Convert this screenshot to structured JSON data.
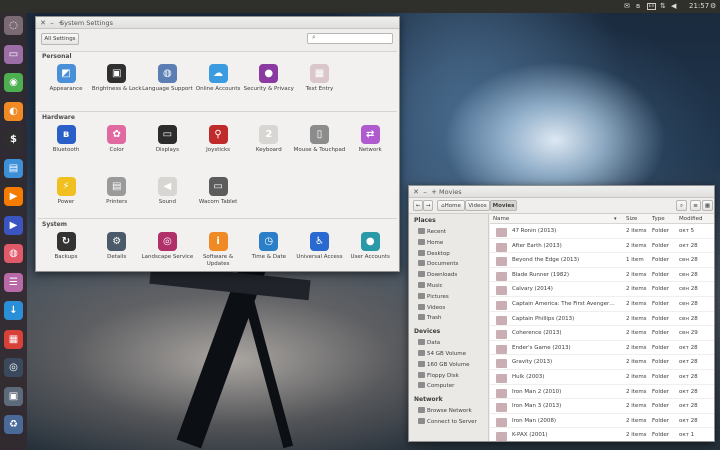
{
  "topbar": {
    "clock": "21:57",
    "indicators": [
      "mail-icon",
      "bluetooth-icon",
      "keyboard-layout-icon",
      "network-icon",
      "sound-icon",
      "power-icon"
    ],
    "layout_label": "En"
  },
  "launcher": [
    {
      "name": "dash-icon",
      "color": "#7a6a74",
      "glyph": "◌"
    },
    {
      "name": "files-icon",
      "color": "#9b6fa6",
      "glyph": "▭"
    },
    {
      "name": "chrome-icon",
      "color": "#4caf50",
      "glyph": "◉"
    },
    {
      "name": "firefox-icon",
      "color": "#f08a24",
      "glyph": "◐"
    },
    {
      "name": "terminal-icon",
      "color": "#2e2e2e",
      "glyph": "$"
    },
    {
      "name": "nautilus-icon",
      "color": "#3d8fd8",
      "glyph": "▤"
    },
    {
      "name": "vlc-icon",
      "color": "#f57c00",
      "glyph": "▶"
    },
    {
      "name": "player-icon",
      "color": "#3b55c0",
      "glyph": "▶"
    },
    {
      "name": "color-icon",
      "color": "#e05a6a",
      "glyph": "◍"
    },
    {
      "name": "settings-icon",
      "color": "#b86aa8",
      "glyph": "☰"
    },
    {
      "name": "download-icon",
      "color": "#2b8fd8",
      "glyph": "↓"
    },
    {
      "name": "calendar-icon",
      "color": "#d8403a",
      "glyph": "▦"
    },
    {
      "name": "steam-icon",
      "color": "#3a4a5c",
      "glyph": "◎"
    },
    {
      "name": "drive-icon",
      "color": "#5c6a7a",
      "glyph": "▣"
    },
    {
      "name": "trash-icon",
      "color": "#4a6a9a",
      "glyph": "♻"
    }
  ],
  "settings": {
    "title": "System Settings",
    "all_settings": "All Settings",
    "sections": [
      {
        "title": "Personal",
        "items": [
          {
            "label": "Appearance",
            "icon": "appearance-icon",
            "color": "#4a90d9",
            "glyph": "◩"
          },
          {
            "label": "Brightness & Lock",
            "icon": "lock-icon",
            "color": "#2f2f2f",
            "glyph": "▣"
          },
          {
            "label": "Language Support",
            "icon": "language-icon",
            "color": "#5b7fb5",
            "glyph": "◍"
          },
          {
            "label": "Online Accounts",
            "icon": "cloud-icon",
            "color": "#3a9be0",
            "glyph": "☁"
          },
          {
            "label": "Security & Privacy",
            "icon": "mask-icon",
            "color": "#8a3aa0",
            "glyph": "●"
          },
          {
            "label": "Text Entry",
            "icon": "text-entry-icon",
            "color": "#d9c7cc",
            "glyph": "▦"
          }
        ]
      },
      {
        "title": "Hardware",
        "items": [
          {
            "label": "Bluetooth",
            "icon": "bluetooth-icon",
            "color": "#2a5fc8",
            "glyph": "ʙ"
          },
          {
            "label": "Color",
            "icon": "color-icon",
            "color": "#e06aa0",
            "glyph": "✿"
          },
          {
            "label": "Displays",
            "icon": "displays-icon",
            "color": "#2c2c2c",
            "glyph": "▭"
          },
          {
            "label": "Joysticks",
            "icon": "joystick-icon",
            "color": "#c02a2a",
            "glyph": "⚲"
          },
          {
            "label": "Keyboard",
            "icon": "keyboard-icon",
            "color": "#d8d6d2",
            "glyph": "2"
          },
          {
            "label": "Mouse & Touchpad",
            "icon": "mouse-icon",
            "color": "#8c8c8c",
            "glyph": "▯"
          },
          {
            "label": "Network",
            "icon": "network-icon",
            "color": "#b05ad0",
            "glyph": "⇄"
          },
          {
            "label": "Power",
            "icon": "power-icon",
            "color": "#f0c020",
            "glyph": "⚡"
          },
          {
            "label": "Printers",
            "icon": "printer-icon",
            "color": "#9a9a9a",
            "glyph": "▤"
          },
          {
            "label": "Sound",
            "icon": "sound-icon",
            "color": "#d8d6d2",
            "glyph": "◀"
          },
          {
            "label": "Wacom Tablet",
            "icon": "tablet-icon",
            "color": "#5c5c5c",
            "glyph": "▭"
          }
        ]
      },
      {
        "title": "System",
        "items": [
          {
            "label": "Backups",
            "icon": "backup-icon",
            "color": "#333333",
            "glyph": "↻"
          },
          {
            "label": "Details",
            "icon": "details-icon",
            "color": "#4a5a6a",
            "glyph": "⚙"
          },
          {
            "label": "Landscape Service",
            "icon": "landscape-icon",
            "color": "#b0306a",
            "glyph": "◎"
          },
          {
            "label": "Software & Updates",
            "icon": "software-icon",
            "color": "#f08a24",
            "glyph": "i"
          },
          {
            "label": "Time & Date",
            "icon": "clock-icon",
            "color": "#2a7fc8",
            "glyph": "◷"
          },
          {
            "label": "Universal Access",
            "icon": "accessibility-icon",
            "color": "#2a6ad0",
            "glyph": "♿"
          },
          {
            "label": "User Accounts",
            "icon": "user-icon",
            "color": "#2a9aa8",
            "glyph": "●"
          }
        ]
      }
    ]
  },
  "files": {
    "title": "Movies",
    "path": [
      {
        "label": "Home"
      },
      {
        "label": "Videos"
      },
      {
        "label": "Movies"
      }
    ],
    "sidebar": [
      {
        "type": "h",
        "label": "Places"
      },
      {
        "type": "i",
        "label": "Recent"
      },
      {
        "type": "i",
        "label": "Home"
      },
      {
        "type": "i",
        "label": "Desktop"
      },
      {
        "type": "i",
        "label": "Documents"
      },
      {
        "type": "i",
        "label": "Downloads"
      },
      {
        "type": "i",
        "label": "Music"
      },
      {
        "type": "i",
        "label": "Pictures"
      },
      {
        "type": "i",
        "label": "Videos"
      },
      {
        "type": "i",
        "label": "Trash"
      },
      {
        "type": "h",
        "label": "Devices"
      },
      {
        "type": "i",
        "label": "Data"
      },
      {
        "type": "i",
        "label": "54 GB Volume"
      },
      {
        "type": "i",
        "label": "160 GB Volume"
      },
      {
        "type": "i",
        "label": "Floppy Disk"
      },
      {
        "type": "i",
        "label": "Computer"
      },
      {
        "type": "h",
        "label": "Network"
      },
      {
        "type": "i",
        "label": "Browse Network"
      },
      {
        "type": "i",
        "label": "Connect to Server"
      }
    ],
    "columns": {
      "name": "Name",
      "size": "Size",
      "type": "Type",
      "modified": "Modified"
    },
    "rows": [
      {
        "name": "47 Ronin (2013)",
        "size": "2 items",
        "type": "Folder",
        "modified": "окт 5"
      },
      {
        "name": "After Earth (2013)",
        "size": "2 items",
        "type": "Folder",
        "modified": "окт 28"
      },
      {
        "name": "Beyond the Edge (2013)",
        "size": "1 item",
        "type": "Folder",
        "modified": "сен 28"
      },
      {
        "name": "Blade Runner (1982)",
        "size": "2 items",
        "type": "Folder",
        "modified": "сен 28"
      },
      {
        "name": "Calvary (2014)",
        "size": "2 items",
        "type": "Folder",
        "modified": "сен 28"
      },
      {
        "name": "Captain America: The First Avenger…",
        "size": "2 items",
        "type": "Folder",
        "modified": "сен 28"
      },
      {
        "name": "Captain Phillips (2013)",
        "size": "2 items",
        "type": "Folder",
        "modified": "сен 28"
      },
      {
        "name": "Coherence (2013)",
        "size": "2 items",
        "type": "Folder",
        "modified": "сен 29"
      },
      {
        "name": "Ender's Game (2013)",
        "size": "2 items",
        "type": "Folder",
        "modified": "окт 28"
      },
      {
        "name": "Gravity (2013)",
        "size": "2 items",
        "type": "Folder",
        "modified": "окт 28"
      },
      {
        "name": "Hulk (2003)",
        "size": "2 items",
        "type": "Folder",
        "modified": "окт 28"
      },
      {
        "name": "Iron Man 2 (2010)",
        "size": "2 items",
        "type": "Folder",
        "modified": "окт 28"
      },
      {
        "name": "Iron Man 3 (2013)",
        "size": "2 items",
        "type": "Folder",
        "modified": "окт 28"
      },
      {
        "name": "Iron Man (2008)",
        "size": "2 items",
        "type": "Folder",
        "modified": "окт 28"
      },
      {
        "name": "K-PAX (2001)",
        "size": "2 items",
        "type": "Folder",
        "modified": "окт 1"
      }
    ]
  }
}
